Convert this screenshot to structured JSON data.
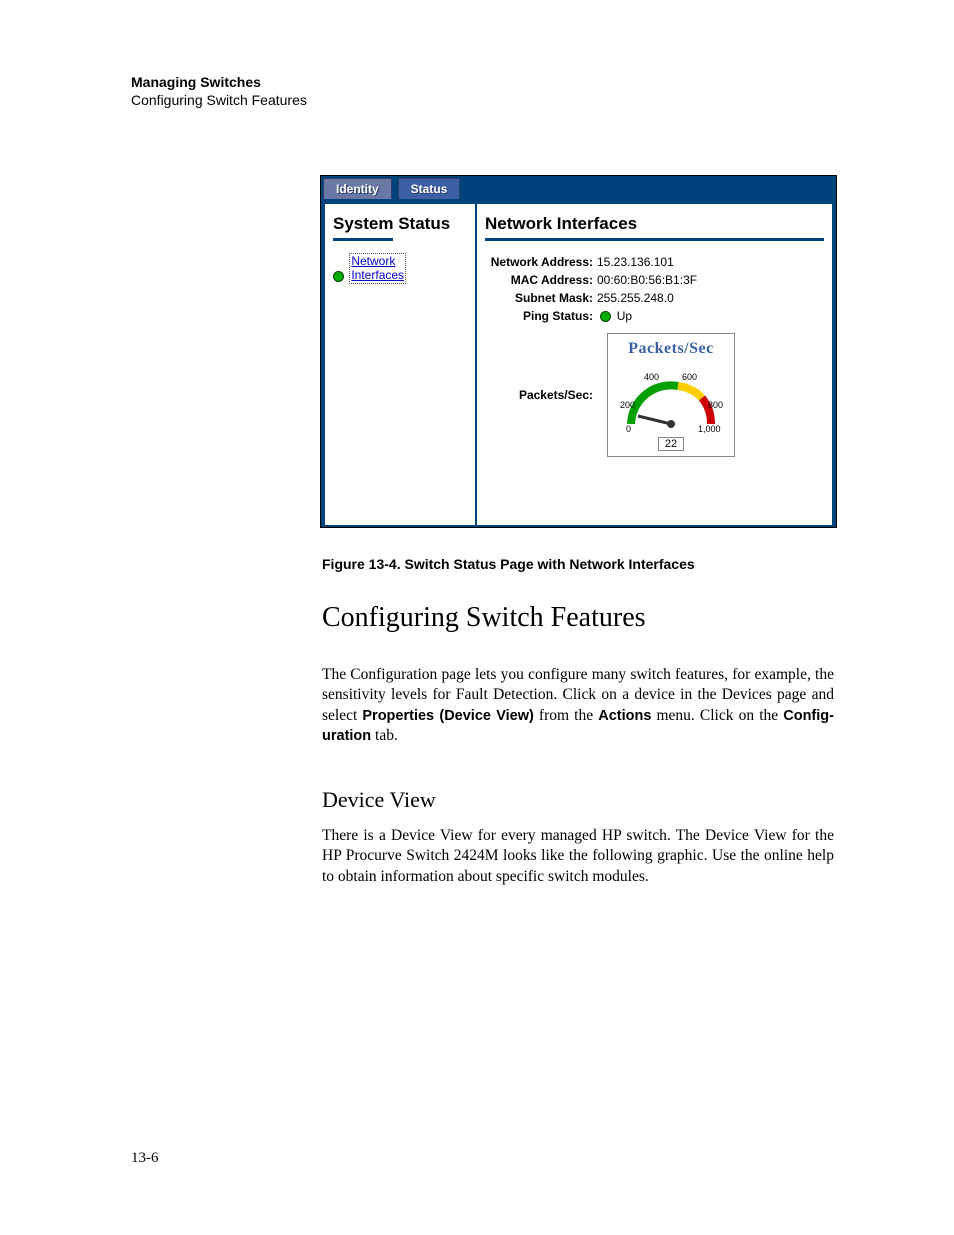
{
  "header": {
    "title": "Managing Switches",
    "subtitle": "Configuring Switch Features"
  },
  "figure": {
    "tabs": {
      "identity": "Identity",
      "status": "Status"
    },
    "left_panel": {
      "title": "System Status",
      "link_line1": "Network",
      "link_line2": "Interfaces"
    },
    "right_panel": {
      "title": "Network Interfaces",
      "rows": {
        "net_addr_k": "Network Address:",
        "net_addr_v": "15.23.136.101",
        "mac_k": "MAC Address:",
        "mac_v": "00:60:B0:56:B1:3F",
        "mask_k": "Subnet Mask:",
        "mask_v": "255.255.248.0",
        "ping_k": "Ping Status:",
        "ping_v": "Up"
      },
      "gauge": {
        "title": "Packets/Sec",
        "label": "Packets/Sec:",
        "ticks": {
          "t0": "0",
          "t200": "200",
          "t400": "400",
          "t600": "600",
          "t800": "800",
          "t1000": "1,000"
        },
        "value": "22"
      }
    }
  },
  "caption": {
    "num": "Figure 13-4.",
    "text": "Switch Status Page with Network Interfaces"
  },
  "section": {
    "title": "Configuring Switch Features"
  },
  "para1": {
    "t1": "The Configuration page lets you configure many switch features, for example, the sensitivity levels for Fault Detection. Click on a device in the Devices page and select ",
    "b1": "Properties (Device View)",
    "t2": " from the ",
    "b2": "Actions",
    "t3": " menu. Click on the ",
    "b3": "Config-uration",
    "t4": " tab."
  },
  "subhead": {
    "title": "Device View"
  },
  "para2": {
    "t1": "There is a Device View for every managed HP switch. The Device View for the HP Procurve Switch 2424M looks like the following graphic. Use the online help to obtain information about specific switch modules."
  },
  "chart_data": {
    "type": "gauge",
    "title": "Packets/Sec",
    "range": [
      0,
      1000
    ],
    "ticks": [
      0,
      200,
      400,
      600,
      800,
      1000
    ],
    "value": 22,
    "zones": [
      {
        "from": 0,
        "to": 600,
        "color": "#00a000"
      },
      {
        "from": 600,
        "to": 800,
        "color": "#ffcc00"
      },
      {
        "from": 800,
        "to": 1000,
        "color": "#cc0000"
      }
    ]
  },
  "page_number": "13-6"
}
